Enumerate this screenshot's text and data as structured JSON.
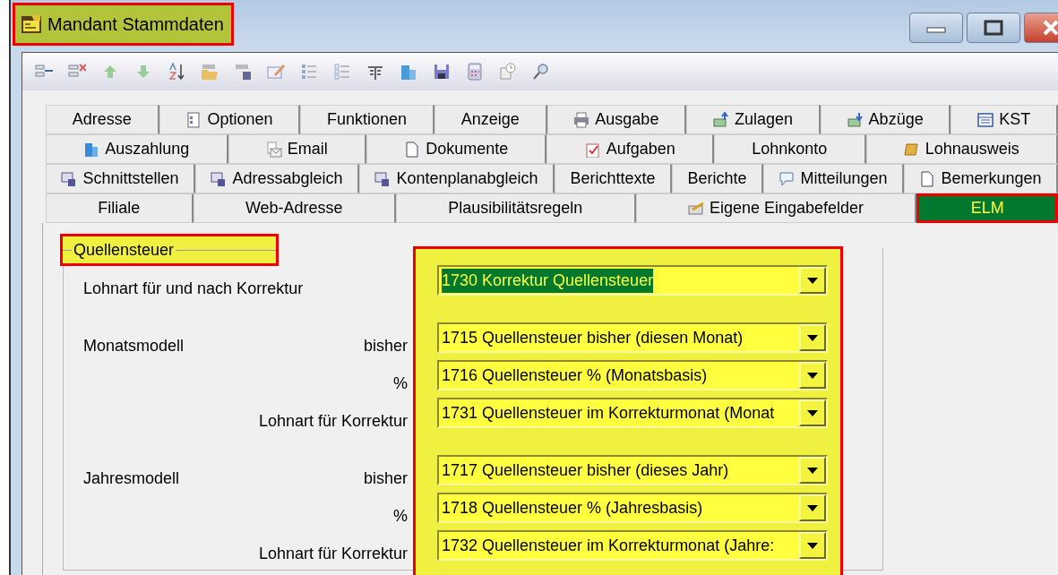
{
  "window": {
    "title": "Mandant Stammdaten"
  },
  "tab_rows": [
    [
      {
        "label": "Adresse",
        "icon": false,
        "selected": false
      },
      {
        "label": "Optionen",
        "icon": true,
        "selected": false
      },
      {
        "label": "Funktionen",
        "icon": false,
        "selected": false
      },
      {
        "label": "Anzeige",
        "icon": false,
        "selected": false
      },
      {
        "label": "Ausgabe",
        "icon": true,
        "selected": false
      },
      {
        "label": "Zulagen",
        "icon": true,
        "selected": false
      },
      {
        "label": "Abzüge",
        "icon": true,
        "selected": false
      },
      {
        "label": "KST",
        "icon": true,
        "selected": false
      }
    ],
    [
      {
        "label": "Auszahlung",
        "icon": true,
        "selected": false
      },
      {
        "label": "Email",
        "icon": true,
        "selected": false
      },
      {
        "label": "Dokumente",
        "icon": true,
        "selected": false
      },
      {
        "label": "Aufgaben",
        "icon": true,
        "selected": false
      },
      {
        "label": "Lohnkonto",
        "icon": false,
        "selected": false
      },
      {
        "label": "Lohnausweis",
        "icon": true,
        "selected": false
      }
    ],
    [
      {
        "label": "Schnittstellen",
        "icon": true,
        "selected": false
      },
      {
        "label": "Adressabgleich",
        "icon": true,
        "selected": false
      },
      {
        "label": "Kontenplanabgleich",
        "icon": true,
        "selected": false
      },
      {
        "label": "Berichttexte",
        "icon": false,
        "selected": false
      },
      {
        "label": "Berichte",
        "icon": false,
        "selected": false
      },
      {
        "label": "Mitteilungen",
        "icon": true,
        "selected": false
      },
      {
        "label": "Bemerkungen",
        "icon": true,
        "selected": false
      }
    ],
    [
      {
        "label": "Filiale",
        "icon": false,
        "selected": false
      },
      {
        "label": "Web-Adresse",
        "icon": false,
        "selected": false
      },
      {
        "label": "Plausibilitätsregeln",
        "icon": false,
        "selected": false
      },
      {
        "label": "Eigene Eingabefelder",
        "icon": true,
        "selected": false
      },
      {
        "label": "ELM",
        "icon": false,
        "selected": true
      }
    ]
  ],
  "group": {
    "title": "Quellensteuer",
    "sections": [
      {
        "label": "Lohnart für und nach Korrektur",
        "fields": [
          {
            "value": "1730 Korrektur Quellensteuer",
            "text_selected": true
          }
        ]
      },
      {
        "label": "Monatsmodell",
        "fields": [
          {
            "sublabel": "bisher",
            "value": "1715 Quellensteuer bisher (diesen Monat)",
            "text_selected": false
          },
          {
            "sublabel": "%",
            "value": "1716 Quellensteuer % (Monatsbasis)",
            "text_selected": false
          },
          {
            "sublabel": "Lohnart für Korrektur",
            "value": "1731 Quellensteuer im Korrekturmonat (Monat",
            "text_selected": false
          }
        ]
      },
      {
        "label": "Jahresmodell",
        "fields": [
          {
            "sublabel": "bisher",
            "value": "1717 Quellensteuer bisher (dieses Jahr)",
            "text_selected": false
          },
          {
            "sublabel": "%",
            "value": "1718 Quellensteuer % (Jahresbasis)",
            "text_selected": false
          },
          {
            "sublabel": "Lohnart für Korrektur",
            "value": "1732 Quellensteuer im Korrekturmonat (Jahre:",
            "text_selected": false
          }
        ]
      }
    ]
  }
}
